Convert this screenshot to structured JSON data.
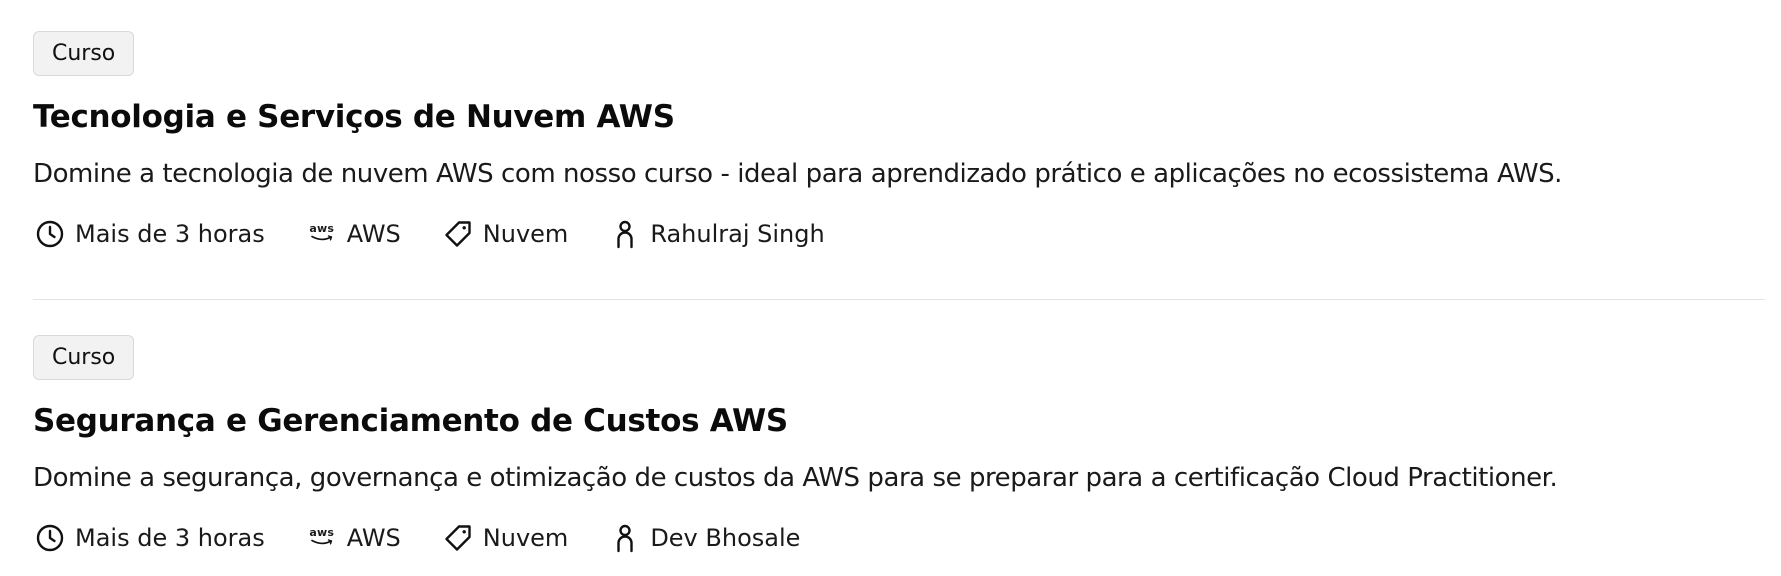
{
  "courses": [
    {
      "badge": "Curso",
      "title": "Tecnologia e Serviços de Nuvem AWS",
      "description": "Domine a tecnologia de nuvem AWS com nosso curso - ideal para aprendizado prático e aplicações no ecossistema AWS.",
      "meta": {
        "duration": "Mais de 3 horas",
        "provider": "AWS",
        "tag": "Nuvem",
        "instructor": "Rahulraj Singh"
      }
    },
    {
      "badge": "Curso",
      "title": "Segurança e Gerenciamento de Custos AWS",
      "description": "Domine a segurança, governança e otimização de custos da AWS para se preparar para a certificação Cloud Practitioner.",
      "meta": {
        "duration": "Mais de 3 horas",
        "provider": "AWS",
        "tag": "Nuvem",
        "instructor": "Dev Bhosale"
      }
    }
  ],
  "icons": {
    "duration": "clock-icon",
    "provider": "aws-logo-icon",
    "tag": "tag-icon",
    "instructor": "person-icon"
  },
  "logo_text": "aws"
}
